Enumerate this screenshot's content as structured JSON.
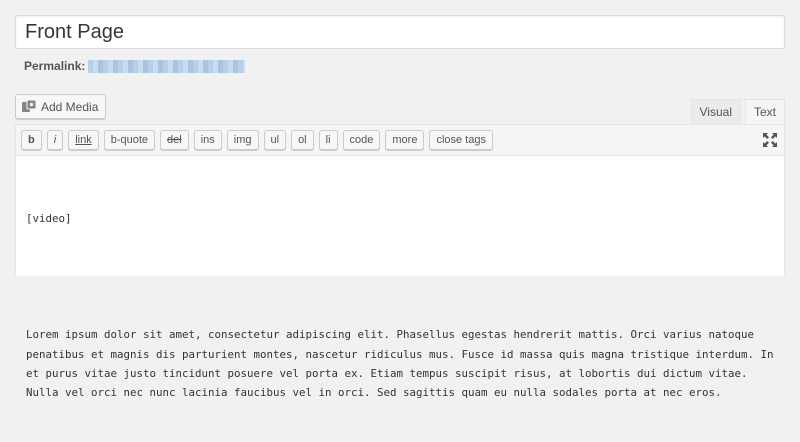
{
  "title": {
    "value": "Front Page"
  },
  "permalink": {
    "label": "Permalink:"
  },
  "media": {
    "add_label": "Add Media"
  },
  "tabs": [
    {
      "label": "Visual",
      "active": false
    },
    {
      "label": "Text",
      "active": true
    }
  ],
  "quicktags": [
    "b",
    "i",
    "link",
    "b-quote",
    "del",
    "ins",
    "img",
    "ul",
    "ol",
    "li",
    "code",
    "more",
    "close tags"
  ],
  "content": {
    "line1": "[video]",
    "paragraph": "Lorem ipsum dolor sit amet, consectetur adipiscing elit. Phasellus egestas hendrerit mattis. Orci varius natoque penatibus et magnis dis parturient montes, nascetur ridiculus mus. Fusce id massa quis magna tristique interdum. In et purus vitae justo tincidunt posuere vel porta ex. Etiam tempus suscipit risus, at lobortis dui dictum vitae. Nulla vel orci nec nunc lacinia faucibus vel in orci. Sed sagittis quam eu nulla sodales porta at nec eros."
  },
  "icons": {
    "add_media": "media-icon",
    "fullscreen": "fullscreen-icon"
  },
  "colors": {
    "accent": "#0073aa",
    "permalink_blur": "#b8cfe8"
  }
}
